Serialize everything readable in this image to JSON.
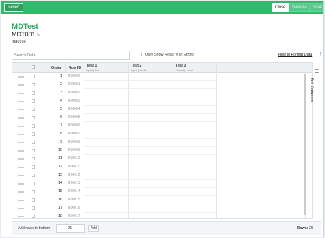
{
  "topbar": {
    "revert_label": "Revert",
    "close_label": "Close",
    "save_as_label": "Save As",
    "save_label": "Save"
  },
  "record": {
    "title": "MDTest",
    "code": "MDT001",
    "status": "Inactive"
  },
  "toolbar": {
    "search_placeholder": "Search Data",
    "only_errors_label": "Only Show Rows With Errors",
    "how_to_link": "How to Format Data"
  },
  "table": {
    "headers": {
      "order": "Order",
      "row_id": "Row ID",
      "test1": "Test 1",
      "test1_sub": "Input | Text",
      "test2": "Test 2",
      "test2_sub": "Input | YesNo",
      "test3": "Test 3",
      "test3_sub": "Output | Level"
    },
    "rows": [
      {
        "order": "1",
        "row_id": "R00000"
      },
      {
        "order": "2",
        "row_id": "R00001"
      },
      {
        "order": "3",
        "row_id": "R00002"
      },
      {
        "order": "4",
        "row_id": "R00003"
      },
      {
        "order": "5",
        "row_id": "R00004"
      },
      {
        "order": "6",
        "row_id": "R00005"
      },
      {
        "order": "7",
        "row_id": "R00006"
      },
      {
        "order": "8",
        "row_id": "R00007"
      },
      {
        "order": "9",
        "row_id": "R00008"
      },
      {
        "order": "10",
        "row_id": "R00009"
      },
      {
        "order": "11",
        "row_id": "R00010"
      },
      {
        "order": "12",
        "row_id": "R00011"
      },
      {
        "order": "13",
        "row_id": "R00012"
      },
      {
        "order": "14",
        "row_id": "R00013"
      },
      {
        "order": "15",
        "row_id": "R00014"
      },
      {
        "order": "16",
        "row_id": "R00015"
      },
      {
        "order": "17",
        "row_id": "R00016"
      },
      {
        "order": "18",
        "row_id": "R00017"
      }
    ],
    "edit_columns_label": "Edit Columns"
  },
  "footer": {
    "add_rows_label": "Add rows to bottom:",
    "add_rows_value": "25",
    "add_button": "Add",
    "rows_label": "Rows:",
    "rows_count": "25"
  },
  "colors": {
    "brand_green": "#31b96e",
    "title_green": "#2fa866"
  },
  "icons": [
    "pencil-icon",
    "kebab-menu-icon",
    "drag-handle-icon",
    "edit-columns-icon"
  ]
}
